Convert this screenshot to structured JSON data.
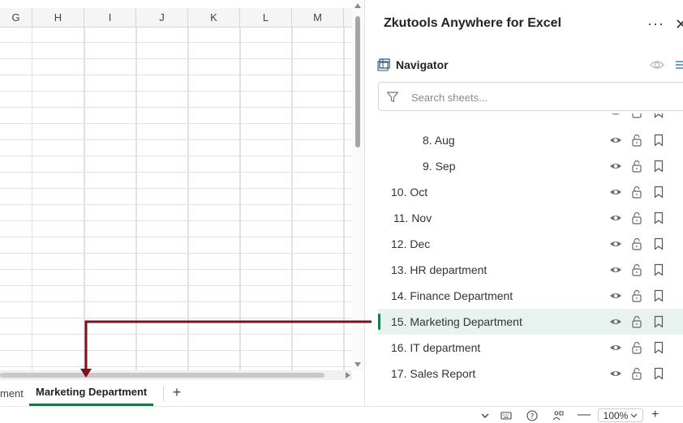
{
  "sheet": {
    "columns": [
      "G",
      "H",
      "I",
      "J",
      "K",
      "L",
      "M"
    ],
    "tabs": {
      "previous_partial": "ment",
      "active": "Marketing Department",
      "add": "+"
    }
  },
  "panel": {
    "title": "Zkutools Anywhere for Excel",
    "more": "···",
    "close": "✕",
    "navigator": {
      "title": "Navigator"
    },
    "search": {
      "placeholder": "Search sheets...",
      "value": ""
    },
    "sheets": [
      {
        "label": "8. Aug"
      },
      {
        "label": "9. Sep"
      },
      {
        "label": "10. Oct"
      },
      {
        "label": "11. Nov"
      },
      {
        "label": "12. Dec"
      },
      {
        "label": "13. HR department"
      },
      {
        "label": "14. Finance Department"
      },
      {
        "label": "15. Marketing Department",
        "active": true
      },
      {
        "label": "16. IT department"
      },
      {
        "label": "17. Sales Report"
      }
    ],
    "row_icons": [
      "eye-icon",
      "unlock-icon",
      "bookmark-icon"
    ]
  },
  "status": {
    "zoom": "100%"
  },
  "colors": {
    "accent": "#1f7a4c",
    "active_row_bg": "#e8f3ef",
    "annotation": "#7b0f1f"
  }
}
